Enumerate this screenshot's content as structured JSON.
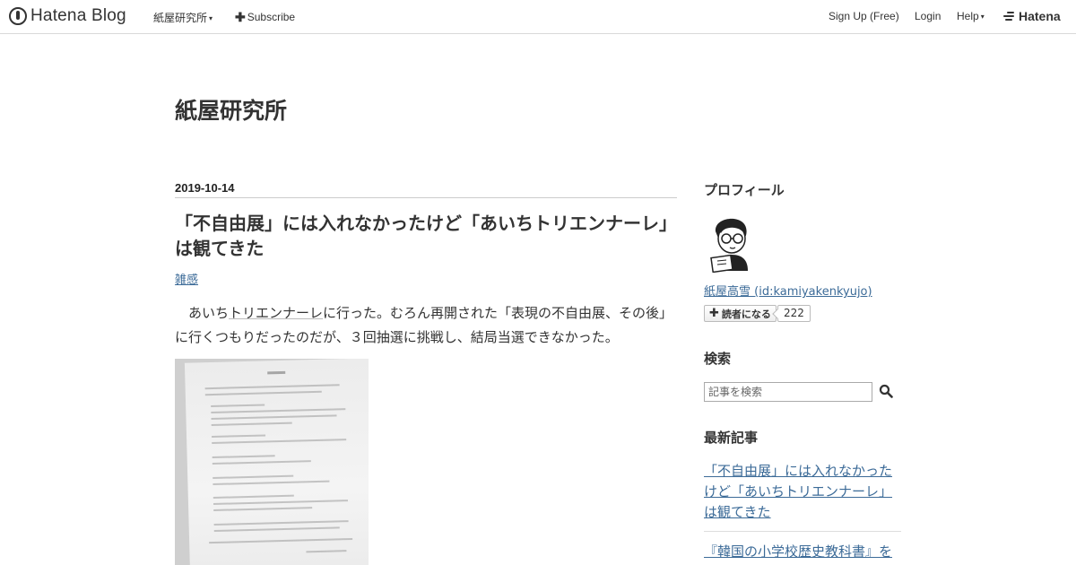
{
  "topbar": {
    "brand": "Hatena Blog",
    "blog_menu": "紙屋研究所",
    "subscribe": "Subscribe",
    "signup": "Sign Up (Free)",
    "login": "Login",
    "help": "Help",
    "hatena": "Hatena"
  },
  "blog": {
    "title": "紙屋研究所"
  },
  "article": {
    "date": "2019-10-14",
    "title": "「不自由展」には入れなかったけど「あいちトリエンナーレ」は観てきた",
    "category": "雑感",
    "body_before_kw": "あいち",
    "body_kw": "トリエンナーレ",
    "body_after_kw": "に行った。むろん再開された「表現の不自由展、その後」に行くつもりだったのだが、３回抽選に挑戦し、結局当選できなかった。"
  },
  "sidebar": {
    "profile_heading": "プロフィール",
    "profile_name": "紙屋高雪 (id:kamiyakenkyujo)",
    "subscribe_label": "読者になる",
    "subscriber_count": "222",
    "search_heading": "検索",
    "search_placeholder": "記事を検索",
    "recent_heading": "最新記事",
    "recent_items": [
      "「不自由展」には入れなかったけど「あいちトリエンナーレ」は観てきた",
      "『韓国の小学校歴史教科書』を"
    ]
  }
}
